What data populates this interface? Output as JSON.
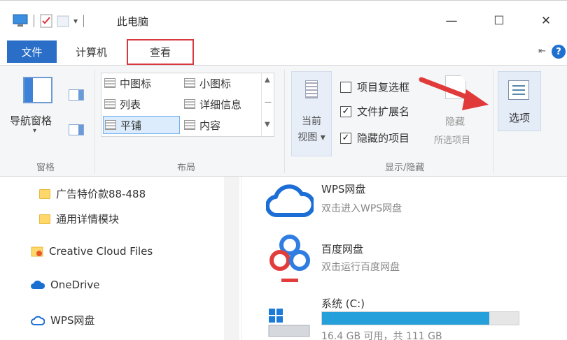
{
  "window": {
    "title": "此电脑",
    "minimize": "—",
    "maximize": "☐",
    "close": "✕"
  },
  "tabs": {
    "file": "文件",
    "computer": "计算机",
    "view": "查看"
  },
  "ribbon": {
    "panes": {
      "nav_pane": "导航窗格",
      "group": "窗格"
    },
    "layout": {
      "items": [
        "中图标",
        "小图标",
        "列表",
        "详细信息",
        "平铺",
        "内容"
      ],
      "selected": "平铺",
      "group": "布局"
    },
    "current_view": {
      "line1": "当前",
      "line2": "视图 ▾"
    },
    "show_hide": {
      "checkboxes": [
        {
          "label": "项目复选框",
          "checked": false
        },
        {
          "label": "文件扩展名",
          "checked": true
        },
        {
          "label": "隐藏的项目",
          "checked": true
        }
      ],
      "hide_label": "隐藏",
      "hide_sub": "所选项目",
      "group": "显示/隐藏"
    },
    "options_label": "选项"
  },
  "nav": {
    "items": [
      "广告特价款88-488",
      "通用详情模块",
      "Creative Cloud Files",
      "OneDrive",
      "WPS网盘"
    ]
  },
  "drives": [
    {
      "title": "WPS网盘",
      "sub": "双击进入WPS网盘"
    },
    {
      "title": "百度网盘",
      "sub": "双击运行百度网盘"
    },
    {
      "title": "系统 (C:)",
      "sub": "16.4 GB 可用，共 111 GB",
      "used_fraction": 0.85
    }
  ],
  "colors": {
    "accent": "#2a6ec8",
    "highlight": "#d9363e",
    "bar": "#26a0da"
  }
}
